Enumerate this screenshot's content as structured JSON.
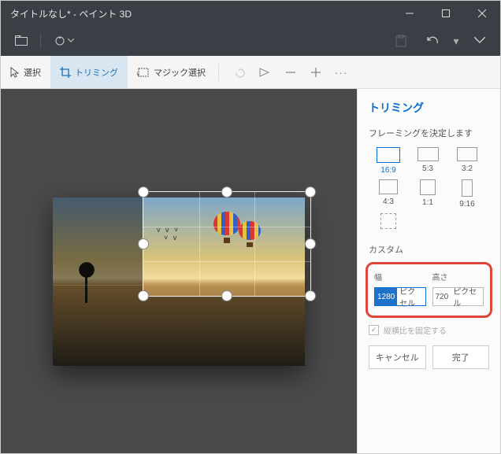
{
  "titlebar": {
    "title": "タイトルなし* - ペイント 3D"
  },
  "toolbar": {
    "select": "選択",
    "crop": "トリミング",
    "magic": "マジック選択"
  },
  "panel": {
    "title": "トリミング",
    "framing": "フレーミングを決定します",
    "ratios": {
      "r169": "16:9",
      "r53": "5:3",
      "r32": "3:2",
      "r43": "4:3",
      "r11": "1:1",
      "r916": "9:16"
    },
    "custom": "カスタム",
    "width_label": "幅",
    "height_label": "高さ",
    "width_value": "1280",
    "height_value": "720",
    "unit": "ピクセル",
    "lock_aspect": "縦横比を固定する",
    "cancel": "キャンセル",
    "done": "完了"
  }
}
